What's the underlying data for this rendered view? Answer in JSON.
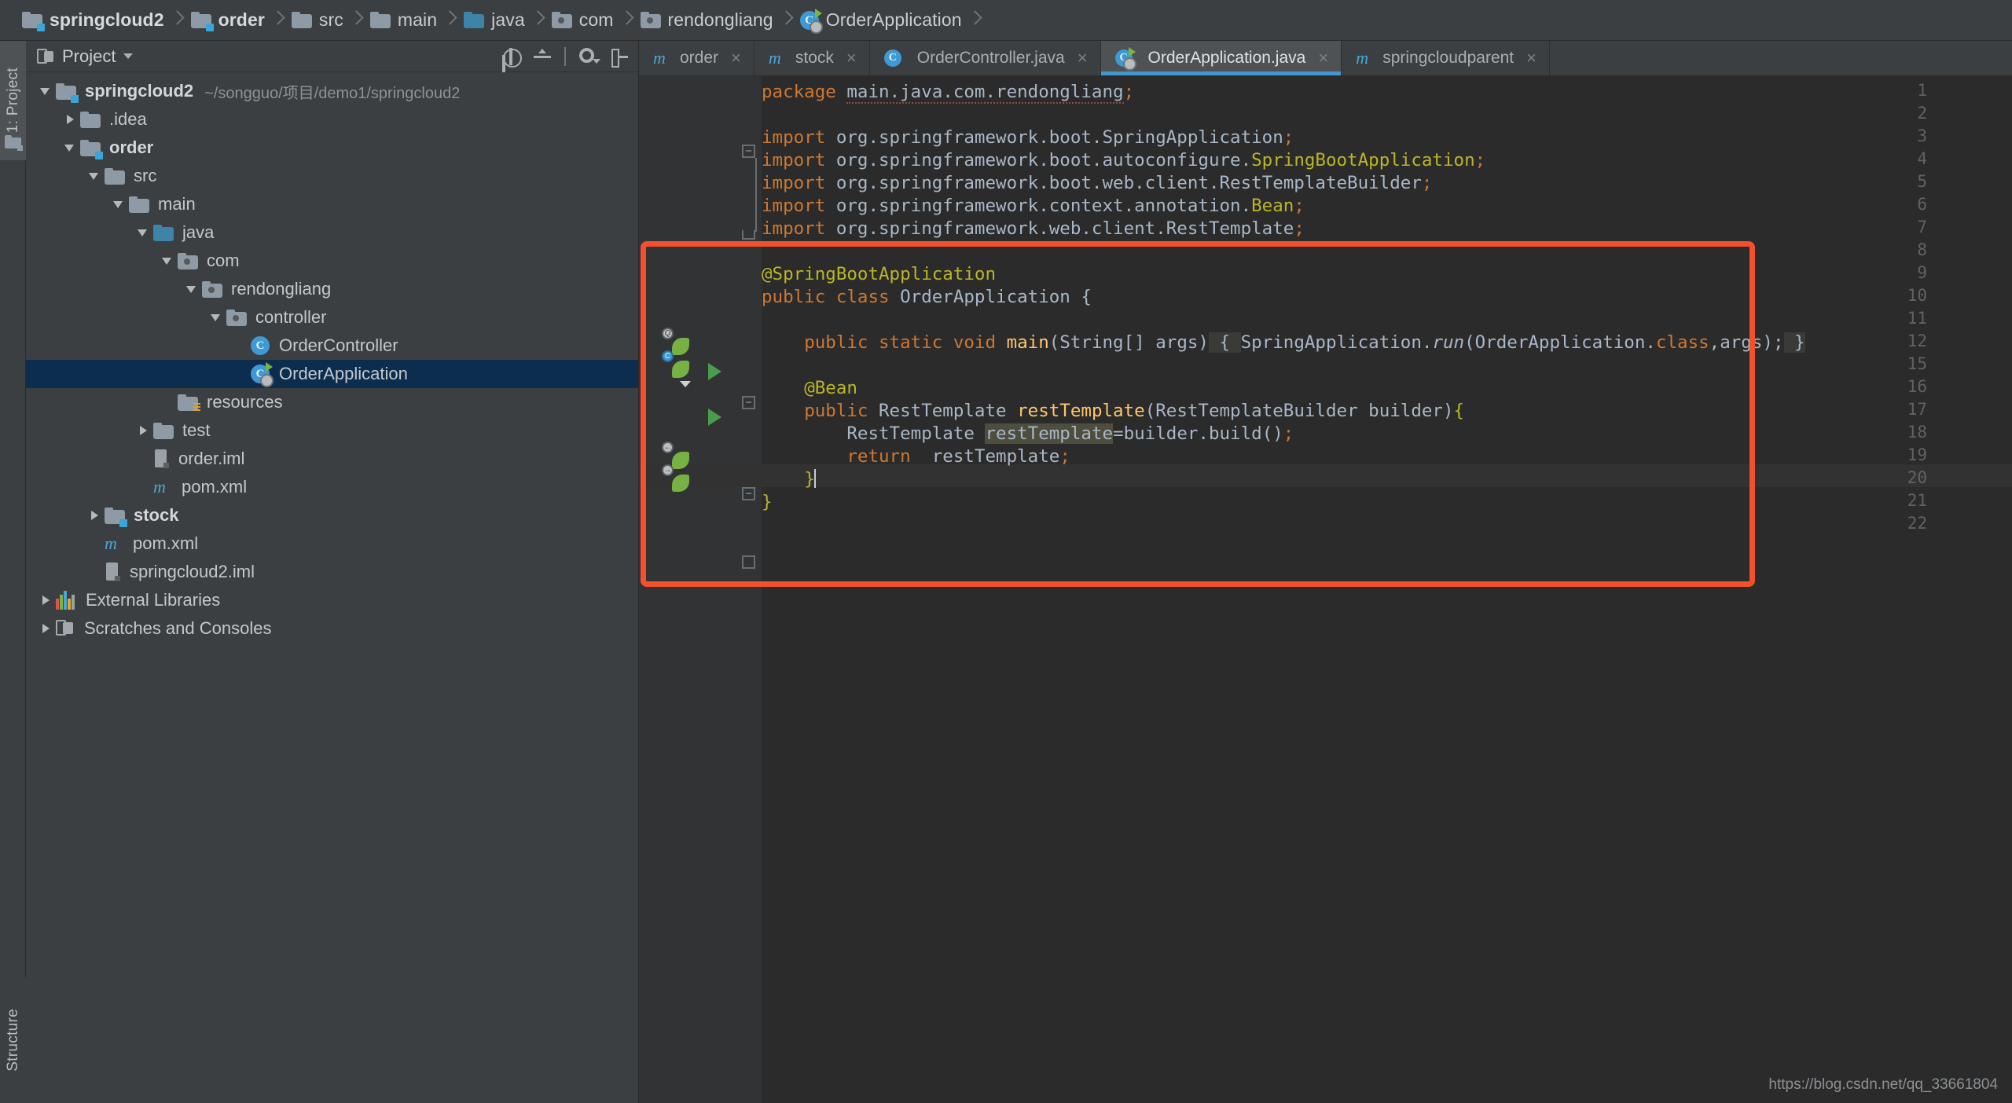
{
  "breadcrumb": [
    {
      "label": "springcloud2",
      "icon": "module-folder-icon",
      "bold": true
    },
    {
      "label": "order",
      "icon": "module-folder-icon",
      "bold": true
    },
    {
      "label": "src",
      "icon": "folder-icon",
      "bold": false
    },
    {
      "label": "main",
      "icon": "folder-icon",
      "bold": false
    },
    {
      "label": "java",
      "icon": "source-folder-icon",
      "bold": false
    },
    {
      "label": "com",
      "icon": "package-folder-icon",
      "bold": false
    },
    {
      "label": "rendongliang",
      "icon": "package-folder-icon",
      "bold": false
    },
    {
      "label": "OrderApplication",
      "icon": "spring-class-icon",
      "bold": false
    }
  ],
  "toolstrip": {
    "project_label": "1: Project",
    "structure_label": "Structure"
  },
  "project_panel": {
    "title": "Project",
    "tools": [
      {
        "name": "locate-icon",
        "tooltip": "Select Opened File"
      },
      {
        "name": "collapse-all-icon",
        "tooltip": "Collapse All"
      },
      {
        "name": "gear-icon",
        "tooltip": "Settings"
      },
      {
        "name": "hide-icon",
        "tooltip": "Hide"
      }
    ],
    "tree": [
      {
        "label": "springcloud2",
        "path": "~/songguo/项目/demo1/springcloud2",
        "indent": 0,
        "arrow": "down",
        "icon": "module-folder-icon",
        "bold": true,
        "selected": false
      },
      {
        "label": ".idea",
        "path": "",
        "indent": 1,
        "arrow": "right",
        "icon": "folder-icon",
        "bold": false,
        "selected": false
      },
      {
        "label": "order",
        "path": "",
        "indent": 1,
        "arrow": "down",
        "icon": "module-folder-icon",
        "bold": true,
        "selected": false
      },
      {
        "label": "src",
        "path": "",
        "indent": 2,
        "arrow": "down",
        "icon": "folder-icon",
        "bold": false,
        "selected": false
      },
      {
        "label": "main",
        "path": "",
        "indent": 3,
        "arrow": "down",
        "icon": "folder-icon",
        "bold": false,
        "selected": false
      },
      {
        "label": "java",
        "path": "",
        "indent": 4,
        "arrow": "down",
        "icon": "source-folder-icon",
        "bold": false,
        "selected": false
      },
      {
        "label": "com",
        "path": "",
        "indent": 5,
        "arrow": "down",
        "icon": "package-folder-icon",
        "bold": false,
        "selected": false
      },
      {
        "label": "rendongliang",
        "path": "",
        "indent": 6,
        "arrow": "down",
        "icon": "package-folder-icon",
        "bold": false,
        "selected": false
      },
      {
        "label": "controller",
        "path": "",
        "indent": 7,
        "arrow": "down",
        "icon": "package-folder-icon",
        "bold": false,
        "selected": false
      },
      {
        "label": "OrderController",
        "path": "",
        "indent": 8,
        "arrow": "none",
        "icon": "class-icon",
        "bold": false,
        "selected": false
      },
      {
        "label": "OrderApplication",
        "path": "",
        "indent": 8,
        "arrow": "none",
        "icon": "spring-class-icon",
        "bold": false,
        "selected": true
      },
      {
        "label": "resources",
        "path": "",
        "indent": 5,
        "arrow": "none",
        "icon": "resources-folder-icon",
        "bold": false,
        "selected": false
      },
      {
        "label": "test",
        "path": "",
        "indent": 4,
        "arrow": "right",
        "icon": "folder-icon",
        "bold": false,
        "selected": false
      },
      {
        "label": "order.iml",
        "path": "",
        "indent": 4,
        "arrow": "none",
        "icon": "iml-file-icon",
        "bold": false,
        "selected": false
      },
      {
        "label": "pom.xml",
        "path": "",
        "indent": 4,
        "arrow": "none",
        "icon": "maven-icon",
        "bold": false,
        "selected": false
      },
      {
        "label": "stock",
        "path": "",
        "indent": 2,
        "arrow": "right",
        "icon": "module-folder-icon",
        "bold": true,
        "selected": false
      },
      {
        "label": "pom.xml",
        "path": "",
        "indent": 2,
        "arrow": "none",
        "icon": "maven-icon",
        "bold": false,
        "selected": false
      },
      {
        "label": "springcloud2.iml",
        "path": "",
        "indent": 2,
        "arrow": "none",
        "icon": "iml-file-icon",
        "bold": false,
        "selected": false
      },
      {
        "label": "External Libraries",
        "path": "",
        "indent": 0,
        "arrow": "right",
        "icon": "libraries-icon",
        "bold": false,
        "selected": false
      },
      {
        "label": "Scratches and Consoles",
        "path": "",
        "indent": 0,
        "arrow": "right",
        "icon": "scratches-icon",
        "bold": false,
        "selected": false
      }
    ]
  },
  "editor": {
    "tabs": [
      {
        "label": "order",
        "icon": "maven-icon",
        "active": false,
        "close": "×"
      },
      {
        "label": "stock",
        "icon": "maven-icon",
        "active": false,
        "close": "×"
      },
      {
        "label": "OrderController.java",
        "icon": "class-icon",
        "active": false,
        "close": "×"
      },
      {
        "label": "OrderApplication.java",
        "icon": "spring-class-icon",
        "active": true,
        "close": "×"
      },
      {
        "label": "springcloudparent",
        "icon": "maven-icon",
        "active": false,
        "close": "×"
      }
    ],
    "line_numbers": [
      "1",
      "2",
      "3",
      "4",
      "5",
      "6",
      "7",
      "8",
      "9",
      "10",
      "11",
      "12",
      "15",
      "16",
      "17",
      "18",
      "19",
      "20",
      "21",
      "22"
    ],
    "code_lines": [
      "package main.java.com.rendongliang;",
      "",
      "import org.springframework.boot.SpringApplication;",
      "import org.springframework.boot.autoconfigure.SpringBootApplication;",
      "import org.springframework.boot.web.client.RestTemplateBuilder;",
      "import org.springframework.context.annotation.Bean;",
      "import org.springframework.web.client.RestTemplate;",
      "",
      "@SpringBootApplication",
      "public class OrderApplication {",
      "",
      "    public static void main(String[] args) { SpringApplication.run(OrderApplication.class,args); }",
      "",
      "    @Bean",
      "    public RestTemplate restTemplate(RestTemplateBuilder builder){",
      "        RestTemplate restTemplate=builder.build();",
      "        return  restTemplate;",
      "    }",
      "}",
      ""
    ],
    "highlight_box_color": "#f4502c"
  },
  "watermark": "https://blog.csdn.net/qq_33661804",
  "colors": {
    "accent": "#4396d0",
    "selection": "#0d2d4f",
    "editor_bg": "#2b2b2b",
    "panel_bg": "#3c3f41",
    "annotation": "#bbb529",
    "keyword": "#cc7832",
    "method": "#ffc66d",
    "highlight": "#f4502c"
  }
}
